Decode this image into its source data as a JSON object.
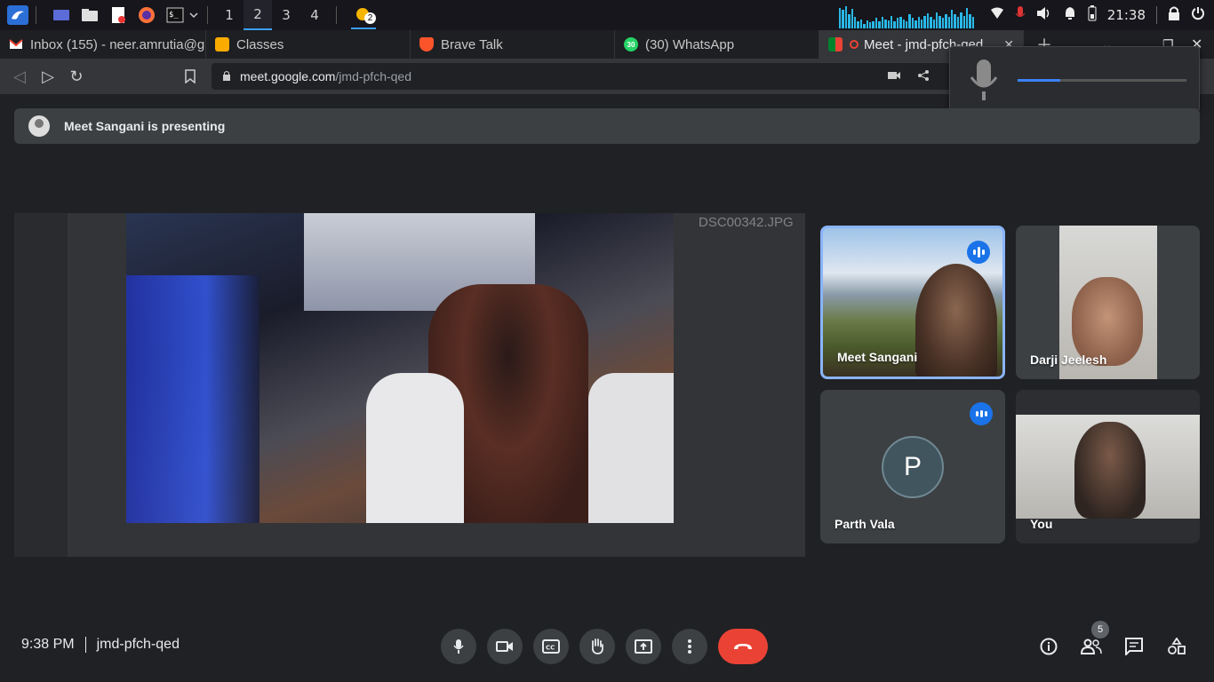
{
  "taskbar": {
    "workspaces": [
      "1",
      "2",
      "3",
      "4"
    ],
    "active_workspace": "2",
    "notification_count": "2",
    "clock": "21:38"
  },
  "tabs": [
    {
      "title": "Inbox (155) - neer.amrutia@g",
      "icon": "gmail-icon"
    },
    {
      "title": "Classes",
      "icon": "classroom-icon"
    },
    {
      "title": "Brave Talk",
      "icon": "brave-icon"
    },
    {
      "title": "(30) WhatsApp",
      "icon": "whatsapp-icon",
      "badge": "30"
    },
    {
      "title": "Meet - jmd-pfch-qed",
      "icon": "meet-icon",
      "active": true
    }
  ],
  "address": {
    "host": "meet.google.com",
    "path": "/jmd-pfch-qed"
  },
  "mic_popup": {
    "level": 0.25
  },
  "presenting": {
    "text": "Meet Sangani is presenting"
  },
  "stage": {
    "filename": "DSC00342.JPG"
  },
  "participants": [
    {
      "name": "Meet Sangani",
      "speaking": true
    },
    {
      "name": "Darji Jeelesh",
      "speaking": false
    },
    {
      "name": "Parth Vala",
      "initial": "P",
      "speaking": true
    },
    {
      "name": "You",
      "speaking": false
    }
  ],
  "bottom": {
    "time": "9:38 PM",
    "meeting_code": "jmd-pfch-qed",
    "people_count": "5"
  },
  "colors": {
    "background": "#202124",
    "surface": "#3c4043",
    "accent": "#1a73e8",
    "end_call": "#ea4335"
  }
}
